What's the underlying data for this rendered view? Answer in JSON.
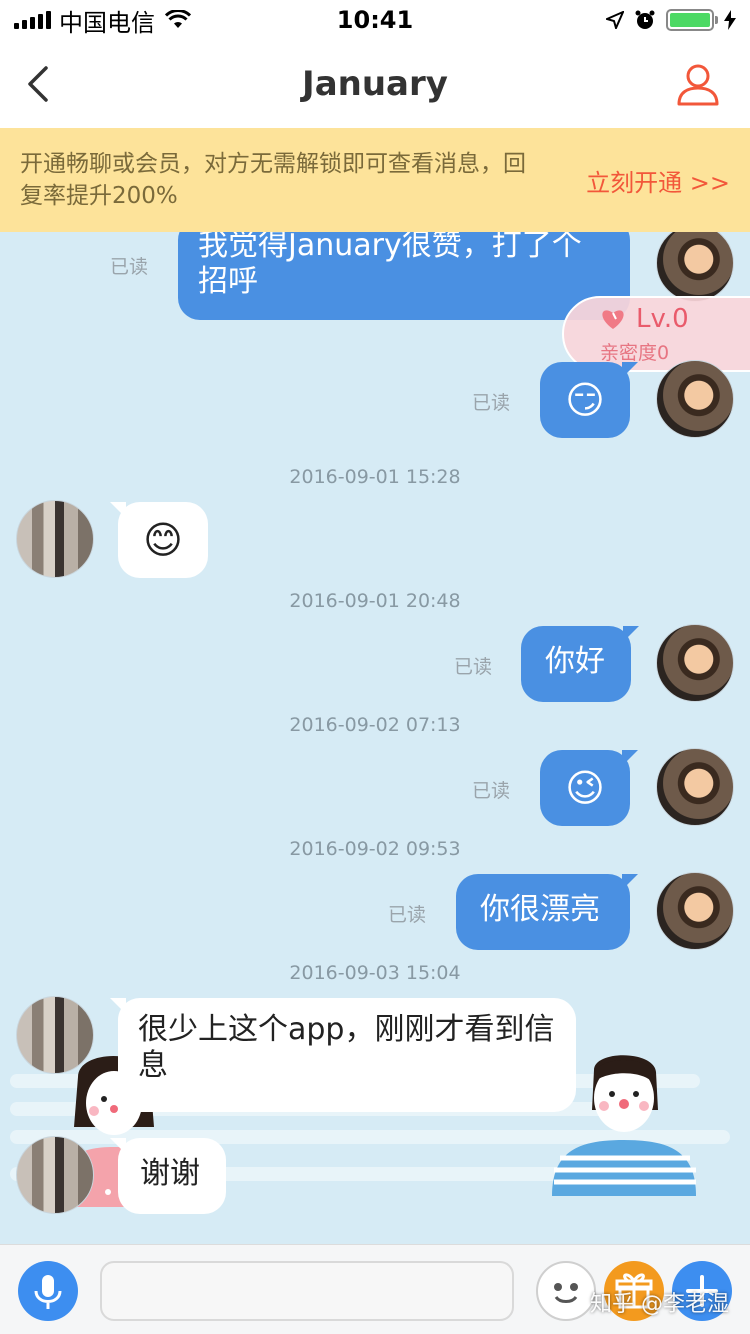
{
  "status_bar": {
    "carrier": "中国电信",
    "time": "10:41"
  },
  "nav": {
    "title": "January"
  },
  "promo": {
    "text": "开通畅聊或会员，对方无需解锁即可查看消息，回复率提升200%",
    "action": "立刻开通 >>"
  },
  "intimacy": {
    "level": "Lv.0",
    "label": "亲密度0"
  },
  "messages": [
    {
      "from": "me",
      "text": "我觉得January很赞，打了个招呼",
      "read": "已读"
    },
    {
      "from": "me",
      "emoji": "😏",
      "read": "已读"
    },
    {
      "timestamp": "2016-09-01 15:28"
    },
    {
      "from": "other",
      "emoji": "😊"
    },
    {
      "timestamp": "2016-09-01 20:48"
    },
    {
      "from": "me",
      "text": "你好",
      "read": "已读"
    },
    {
      "timestamp": "2016-09-02 07:13"
    },
    {
      "from": "me",
      "emoji": "😉",
      "read": "已读"
    },
    {
      "timestamp": "2016-09-02 09:53"
    },
    {
      "from": "me",
      "text": "你很漂亮",
      "read": "已读"
    },
    {
      "timestamp": "2016-09-03 15:04"
    },
    {
      "from": "other",
      "text": "很少上这个app，刚刚才看到信息"
    },
    {
      "from": "other",
      "text": "谢谢"
    }
  ],
  "input_bar": {
    "placeholder": "",
    "icons": [
      "microphone-icon",
      "emoji-face-icon",
      "gift-icon",
      "plus-icon"
    ]
  },
  "watermark": "知乎 @李老湿",
  "colors": {
    "chat_background": "#d6ebf5",
    "my_bubble": "#4a90e2",
    "promo_background": "#fde39a",
    "promo_action": "#f2573a",
    "accent_blue": "#3d8ef0",
    "gift_orange": "#f39a1e"
  }
}
